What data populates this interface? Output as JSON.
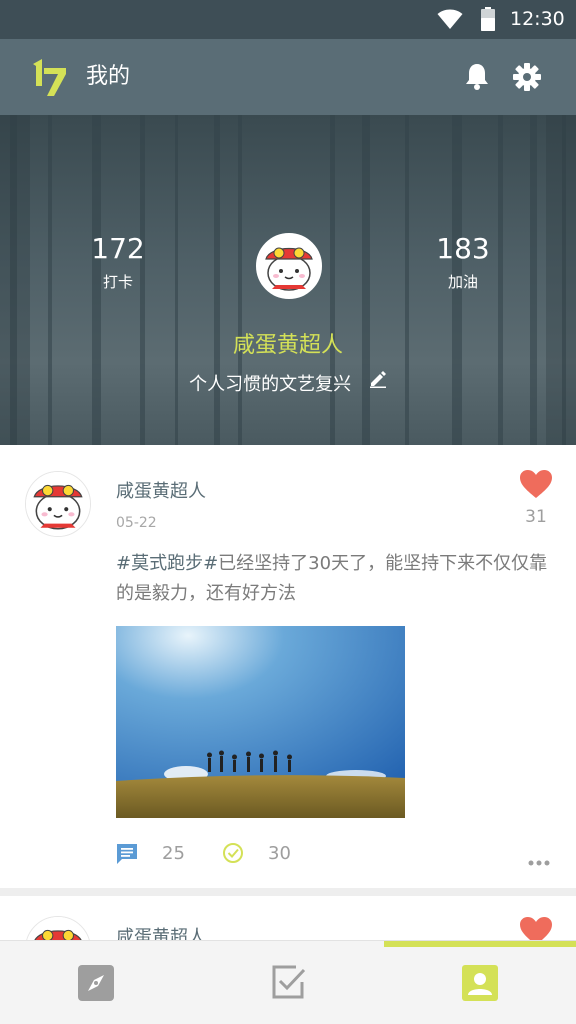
{
  "status_bar": {
    "time": "12:30"
  },
  "app_bar": {
    "title": "我的"
  },
  "profile": {
    "checkins_count": "172",
    "checkins_label": "打卡",
    "cheers_count": "183",
    "cheers_label": "加油",
    "name": "咸蛋黄超人",
    "motto": "个人习惯的文艺复兴"
  },
  "posts": [
    {
      "author": "咸蛋黄超人",
      "date": "05-22",
      "likes": "31",
      "tag": "#莫式跑步#",
      "text": "已经坚持了30天了，能坚持下来不仅仅靠的是毅力，还有好方法",
      "comments": "25",
      "checks": "30"
    },
    {
      "author": "咸蛋黄超人"
    }
  ],
  "colors": {
    "accent": "#d4e157",
    "header": "#5a6d76",
    "status_bar": "#3e4e56",
    "heart": "#ef6c5c",
    "comment_icon": "#5b9bd5"
  },
  "bottom_nav": {
    "items": [
      {
        "icon": "compass-icon"
      },
      {
        "icon": "checkbox-icon"
      },
      {
        "icon": "profile-icon"
      }
    ],
    "active": 2
  }
}
